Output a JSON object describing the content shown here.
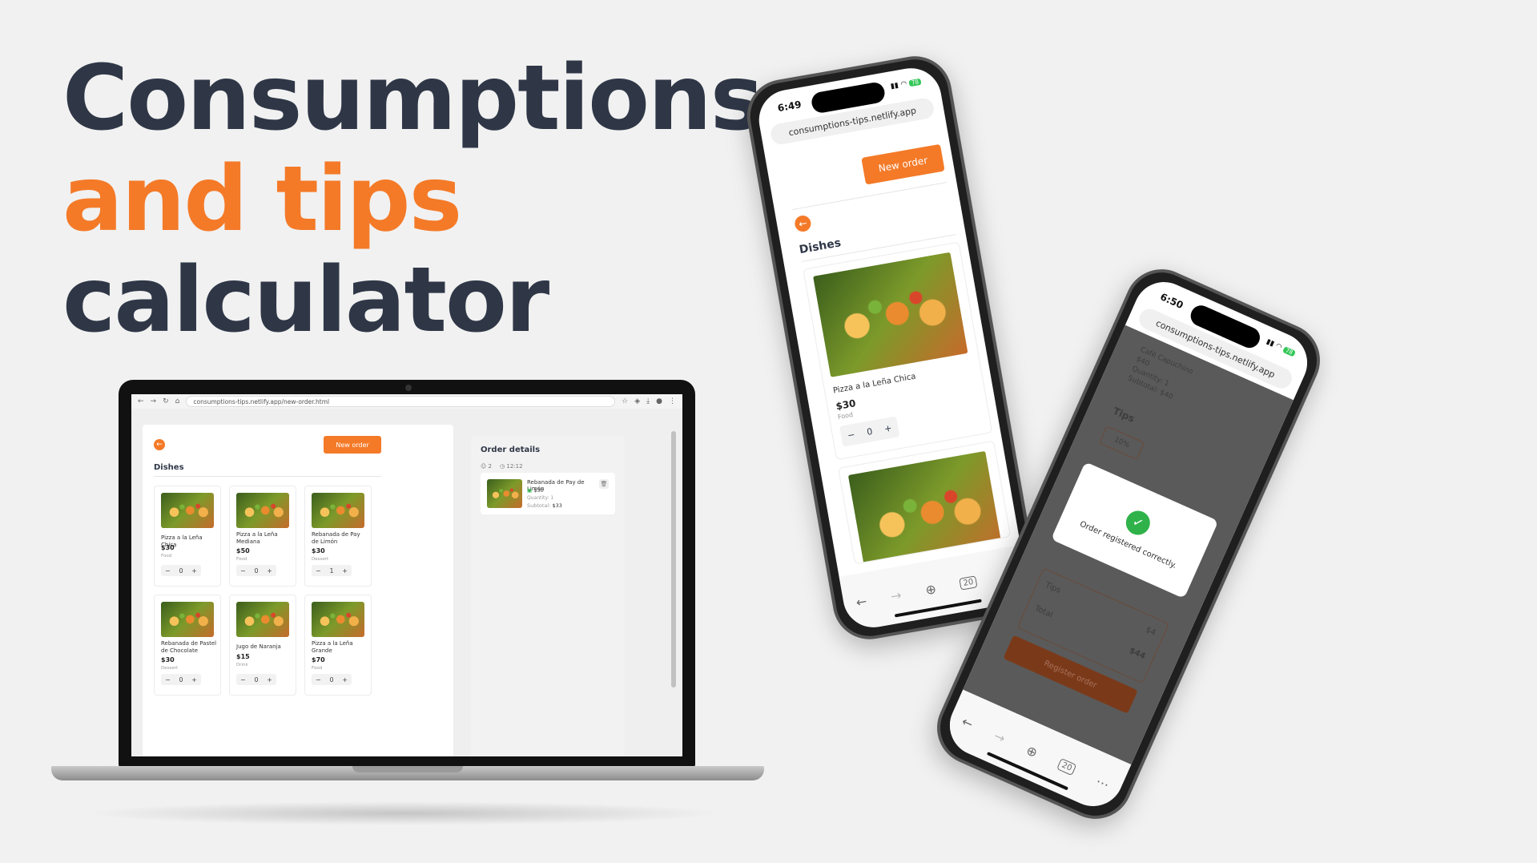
{
  "hero": {
    "line1": "Consumptions",
    "line2": "and tips",
    "line3": "calculator"
  },
  "colors": {
    "accent": "#f47a28",
    "dark": "#2f3747",
    "success": "#2fb24a"
  },
  "laptop": {
    "browser": {
      "url": "consumptions-tips.netlify.app/new-order.html"
    },
    "new_order_label": "New order",
    "dishes_title": "Dishes",
    "dishes": [
      {
        "name": "Pizza a la Leña Chica",
        "price": "$30",
        "category": "Food",
        "qty": "0"
      },
      {
        "name": "Pizza a la Leña Mediana",
        "price": "$50",
        "category": "Food",
        "qty": "0"
      },
      {
        "name": "Rebanada de Pay de Limón",
        "price": "$30",
        "category": "Dessert",
        "qty": "1"
      },
      {
        "name": "Rebanada de Pastel de Chocolate",
        "price": "$30",
        "category": "Dessert",
        "qty": "0"
      },
      {
        "name": "Jugo de Naranja",
        "price": "$15",
        "category": "Drink",
        "qty": "0"
      },
      {
        "name": "Pizza a la Leña Grande",
        "price": "$70",
        "category": "Food",
        "qty": "0"
      }
    ],
    "order": {
      "title": "Order details",
      "table": "2",
      "time": "12:12",
      "item": {
        "name": "Rebanada de Pay de Limón",
        "price": "$30",
        "quantity": "Quantity: 1",
        "subtotal_label": "Subtotal:",
        "subtotal": "$33"
      }
    }
  },
  "phone1": {
    "time": "6:49",
    "battery": "78",
    "url": "consumptions-tips.netlify.app",
    "new_order_label": "New order",
    "dishes_title": "Dishes",
    "dish": {
      "name": "Pizza a la Leña Chica",
      "price": "$30",
      "category": "Food",
      "qty": "0"
    },
    "tabs_count": "20"
  },
  "phone2": {
    "time": "6:50",
    "battery": "78",
    "url": "consumptions-tips.netlify.app",
    "bg_item": {
      "name": "Café Capuchino",
      "price": "$40",
      "quantity": "Quantity: 1",
      "subtotal": "Subtotal: $40"
    },
    "tips_title": "Tips",
    "tip_option": "10%",
    "tips_label": "Tips",
    "tips_value": "$4",
    "total_label": "Total",
    "total_value": "$44",
    "register_label": "Register order",
    "modal_message": "Order registered correctly.",
    "tabs_count": "20"
  }
}
